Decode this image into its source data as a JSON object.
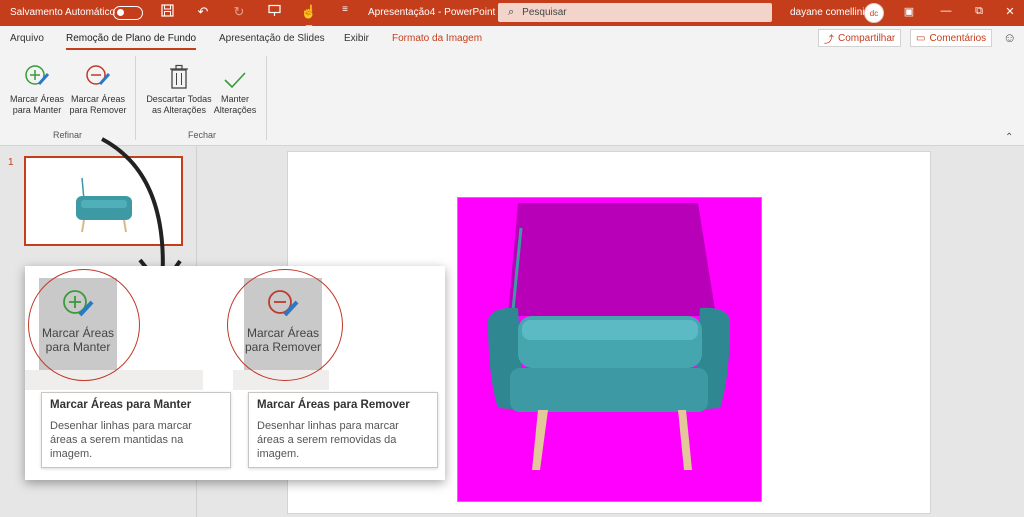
{
  "titlebar": {
    "autosave_label": "Salvamento Automático",
    "doc_title": "Apresentação4  -  PowerPoint",
    "search_placeholder": "Pesquisar",
    "user_name": "dayane comellini",
    "avatar_initials": "dc",
    "icons": [
      "save-icon",
      "undo-icon",
      "redo-icon",
      "present-icon",
      "touch-mode-icon",
      "customize-icon"
    ],
    "window_buttons": [
      "ribbon-display-icon",
      "minimize-icon",
      "restore-icon",
      "close-icon"
    ]
  },
  "tabs": [
    {
      "label": "Arquivo",
      "active": false
    },
    {
      "label": "Remoção de Plano de Fundo",
      "active": true
    },
    {
      "label": "Apresentação de Slides",
      "active": false
    },
    {
      "label": "Exibir",
      "active": false
    },
    {
      "label": "Formato da Imagem",
      "active": false
    }
  ],
  "share": {
    "label": "Compartilhar"
  },
  "comments": {
    "label": "Comentários"
  },
  "ribbon": {
    "refine": {
      "label": "Refinar",
      "keep": {
        "line1": "Marcar Áreas",
        "line2": "para Manter"
      },
      "remove": {
        "line1": "Marcar Áreas",
        "line2": "para Remover"
      }
    },
    "close": {
      "label": "Fechar",
      "discard": {
        "line1": "Descartar Todas",
        "line2": "as Alterações"
      },
      "keep_changes": {
        "line1": "Manter",
        "line2": "Alterações"
      }
    }
  },
  "slides": {
    "number": "1"
  },
  "zoom": {
    "keep": {
      "line1": "Marcar Áreas",
      "line2": "para Manter"
    },
    "remove": {
      "line1": "Marcar Áreas",
      "line2": "para Remover"
    },
    "tooltip_keep": {
      "title": "Marcar Áreas para Manter",
      "desc": "Desenhar linhas para marcar áreas a serem mantidas na imagem."
    },
    "tooltip_remove": {
      "title": "Marcar Áreas para Remover",
      "desc": "Desenhar linhas para marcar áreas a serem removidas da imagem."
    }
  },
  "colors": {
    "accent": "#c43e1c",
    "removal_magenta": "#ff00ff",
    "chair_teal": "#3d9aa4"
  }
}
